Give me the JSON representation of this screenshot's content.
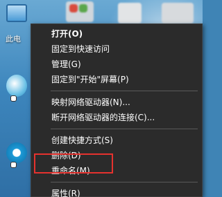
{
  "desktop": {
    "icons": [
      {
        "name": "this-pc",
        "label": "此电"
      }
    ]
  },
  "context_menu": {
    "items": [
      {
        "label": "打开(O)",
        "bold": true
      },
      {
        "label": "固定到快速访问"
      },
      {
        "label": "管理(G)"
      },
      {
        "label": "固定到\"开始\"屏幕(P)"
      },
      {
        "separator": true
      },
      {
        "label": "映射网络驱动器(N)..."
      },
      {
        "label": "断开网络驱动器的连接(C)..."
      },
      {
        "separator": true
      },
      {
        "label": "创建快捷方式(S)"
      },
      {
        "label": "删除(D)"
      },
      {
        "label": "重命名(M)"
      },
      {
        "separator": true
      },
      {
        "label": "属性(R)"
      }
    ],
    "highlighted_item": "属性(R)",
    "highlight_color": "#e6322e"
  }
}
